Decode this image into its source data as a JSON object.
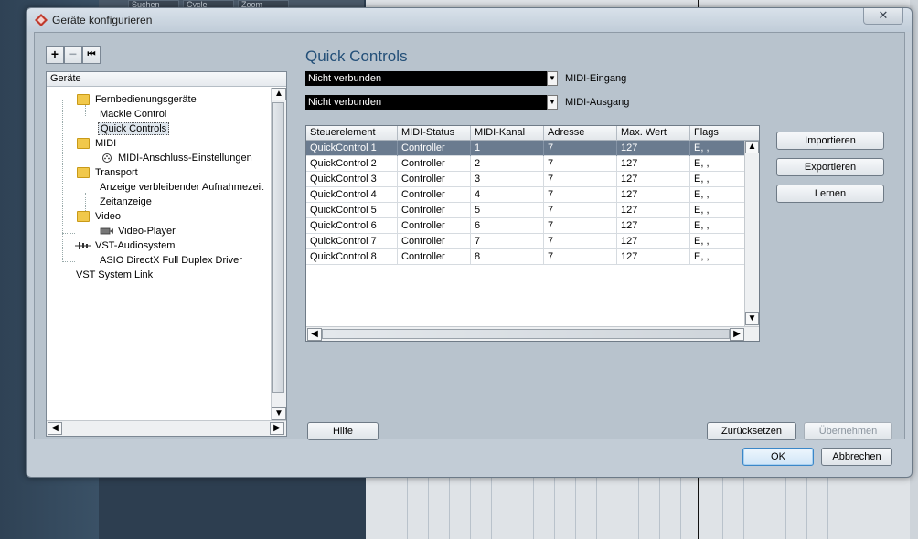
{
  "background": {
    "topbar_segments": [
      "Suchen",
      "Cycle",
      "Zoom"
    ]
  },
  "window": {
    "title": "Geräte konfigurieren",
    "close_symbol": "✕"
  },
  "tree": {
    "toolbar": {
      "add": "+",
      "remove": "−",
      "reset": "⏮"
    },
    "header": "Geräte",
    "items": [
      {
        "label": "Fernbedienungsgeräte",
        "icon": "folder-icon"
      },
      {
        "label": "Mackie Control",
        "icon": ""
      },
      {
        "label": "Quick Controls",
        "icon": "",
        "selected": true
      },
      {
        "label": "MIDI",
        "icon": "folder-icon"
      },
      {
        "label": "MIDI-Anschluss-Einstellungen",
        "icon": "midi-port-icon"
      },
      {
        "label": "Transport",
        "icon": "folder-icon"
      },
      {
        "label": "Anzeige verbleibender Aufnahmezeit",
        "icon": ""
      },
      {
        "label": "Zeitanzeige",
        "icon": ""
      },
      {
        "label": "Video",
        "icon": "folder-icon"
      },
      {
        "label": "Video-Player",
        "icon": "video-player-icon"
      },
      {
        "label": "VST-Audiosystem",
        "icon": "audio-system-icon"
      },
      {
        "label": "ASIO DirectX Full Duplex Driver",
        "icon": ""
      },
      {
        "label": "VST System Link",
        "icon": ""
      }
    ]
  },
  "panel": {
    "title": "Quick Controls",
    "midi_in": {
      "value": "Nicht verbunden",
      "label": "MIDI-Eingang"
    },
    "midi_out": {
      "value": "Nicht verbunden",
      "label": "MIDI-Ausgang"
    },
    "table": {
      "columns": [
        "Steuerelement",
        "MIDI-Status",
        "MIDI-Kanal",
        "Adresse",
        "Max. Wert",
        "Flags"
      ],
      "rows": [
        [
          "QuickControl 1",
          "Controller",
          "1",
          "7",
          "127",
          "E, ,"
        ],
        [
          "QuickControl 2",
          "Controller",
          "2",
          "7",
          "127",
          "E, ,"
        ],
        [
          "QuickControl 3",
          "Controller",
          "3",
          "7",
          "127",
          "E, ,"
        ],
        [
          "QuickControl 4",
          "Controller",
          "4",
          "7",
          "127",
          "E, ,"
        ],
        [
          "QuickControl 5",
          "Controller",
          "5",
          "7",
          "127",
          "E, ,"
        ],
        [
          "QuickControl 6",
          "Controller",
          "6",
          "7",
          "127",
          "E, ,"
        ],
        [
          "QuickControl 7",
          "Controller",
          "7",
          "7",
          "127",
          "E, ,"
        ],
        [
          "QuickControl 8",
          "Controller",
          "8",
          "7",
          "127",
          "E, ,"
        ]
      ],
      "selected_row": 0
    },
    "buttons": {
      "import": "Importieren",
      "export": "Exportieren",
      "learn": "Lernen"
    }
  },
  "footer": {
    "help": "Hilfe",
    "reset": "Zurücksetzen",
    "apply": "Übernehmen",
    "ok": "OK",
    "cancel": "Abbrechen"
  },
  "colors": {
    "accent": "#234f78",
    "selection": "#6a7b8f",
    "dialog": "#c2ccd6"
  }
}
